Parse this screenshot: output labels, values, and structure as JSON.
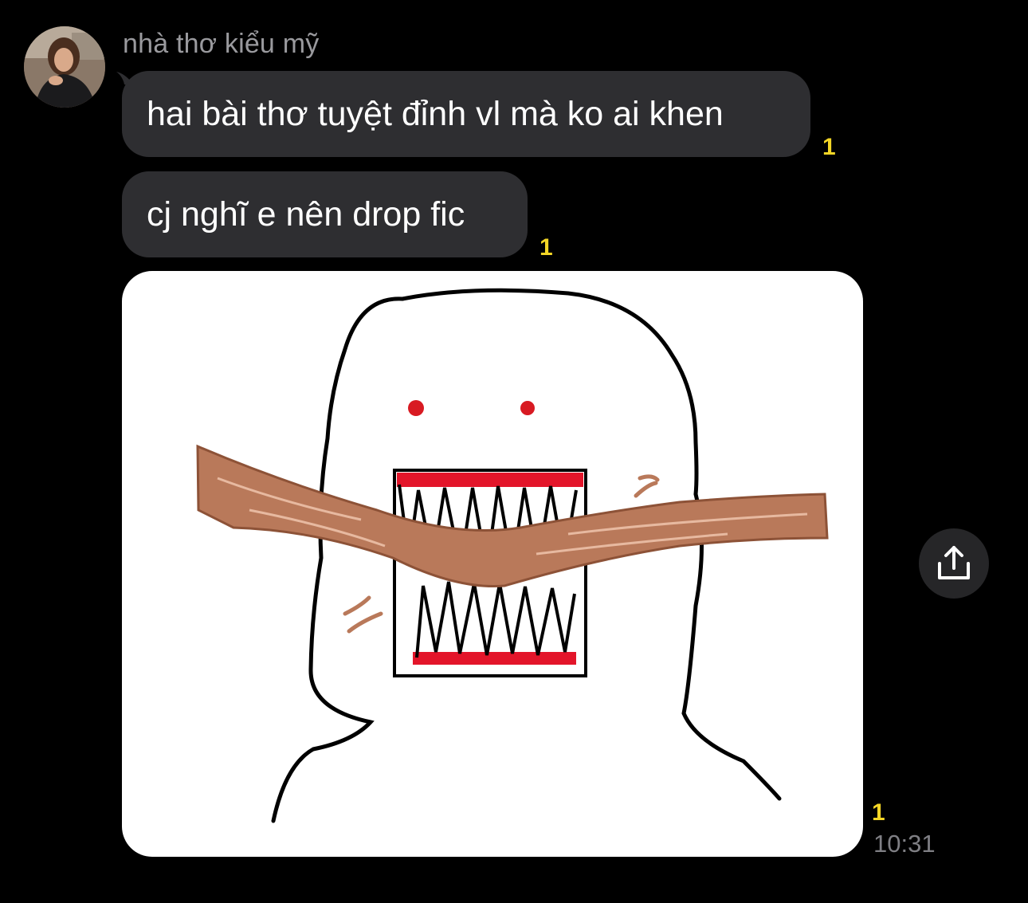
{
  "chat": {
    "sender_name": "nhà thơ kiểu mỹ",
    "messages": [
      {
        "type": "text",
        "text": "hai bài thơ tuyệt đỉnh vl mà ko ai khen",
        "unread_count": "1"
      },
      {
        "type": "text",
        "text": "cj nghĩ e nên drop fic",
        "unread_count": "1"
      },
      {
        "type": "image",
        "unread_count": "1",
        "time": "10:31"
      }
    ]
  },
  "actions": {
    "share_icon": "share-icon"
  },
  "colors": {
    "background": "#000000",
    "bubble": "#2e2e31",
    "unread": "#f4d626",
    "sender": "#9a9a9e",
    "time": "#7f7f84"
  }
}
